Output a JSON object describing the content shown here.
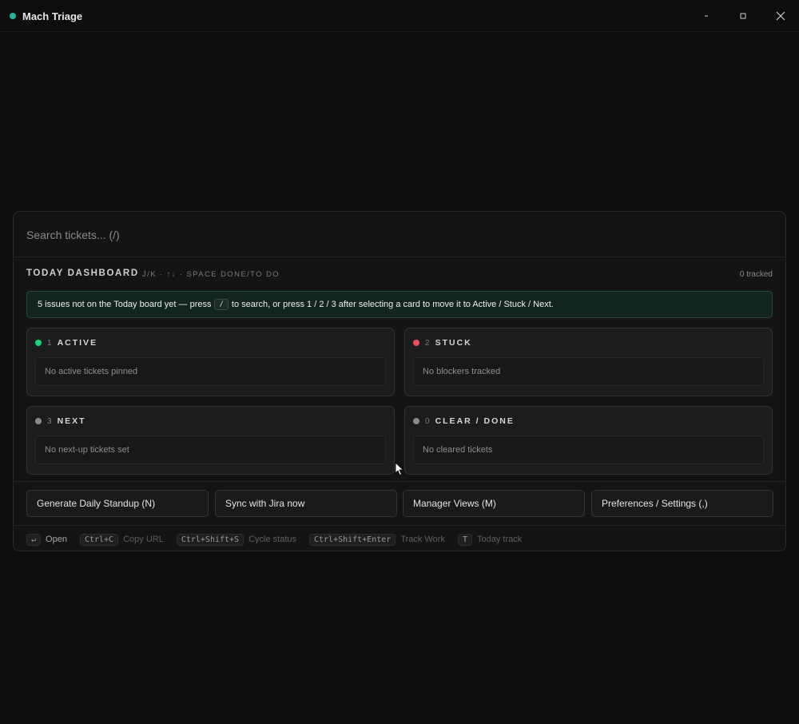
{
  "window": {
    "title": "Mach Triage",
    "accent": "#21b39b",
    "controls": {
      "minimize": "minimize-icon",
      "maximize": "maximize-icon",
      "close": "close-icon"
    }
  },
  "search": {
    "placeholder": "Search tickets... (/)",
    "value": ""
  },
  "dashboard": {
    "title": "TODAY DASHBOARD",
    "hint": "J/K · ↑↓ · SPACE DONE/TO DO",
    "tracked": "0 tracked"
  },
  "notice": {
    "before": "5 issues not on the Today board yet — press",
    "key": "/",
    "after": "to search, or press 1 / 2 / 3 after selecting a card to move it to Active / Stuck / Next."
  },
  "lanes": [
    {
      "num": "1",
      "label": "ACTIVE",
      "empty": "No active tickets pinned",
      "color": "#1fcf7f"
    },
    {
      "num": "2",
      "label": "STUCK",
      "empty": "No blockers tracked",
      "color": "#e8505b"
    },
    {
      "num": "3",
      "label": "NEXT",
      "empty": "No next-up tickets set",
      "color": "#8a8a8a"
    },
    {
      "num": "0",
      "label": "CLEAR / DONE",
      "empty": "No cleared tickets",
      "color": "#8a8a8a"
    }
  ],
  "actions": [
    "Generate Daily Standup (N)",
    "Sync with Jira now",
    "Manager Views (M)",
    "Preferences / Settings (,)"
  ],
  "footer": [
    {
      "key": "↵",
      "label": "Open"
    },
    {
      "key": "Ctrl+C",
      "label": "Copy URL"
    },
    {
      "key": "Ctrl+Shift+S",
      "label": "Cycle status"
    },
    {
      "key": "Ctrl+Shift+Enter",
      "label": "Track Work"
    },
    {
      "key": "T",
      "label": "Today track"
    }
  ]
}
